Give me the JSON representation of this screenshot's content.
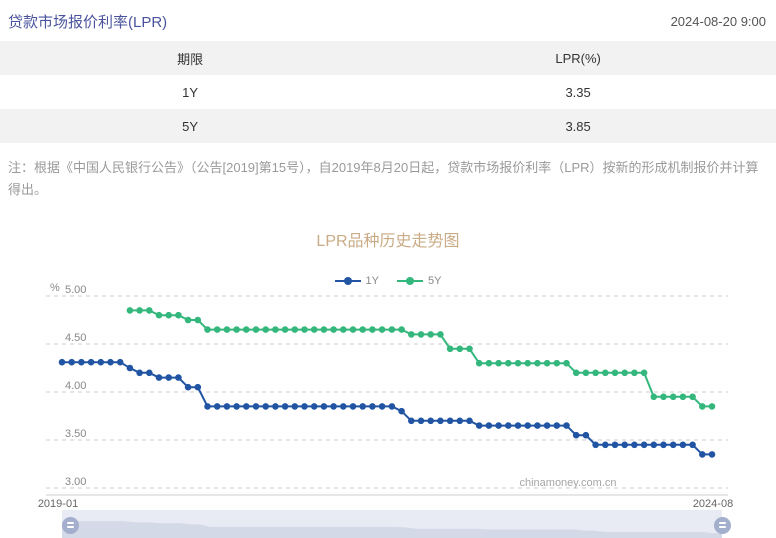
{
  "header": {
    "title": "贷款市场报价利率(LPR)",
    "datetime": "2024-08-20 9:00"
  },
  "table": {
    "columns": [
      "期限",
      "LPR(%)"
    ],
    "rows": [
      {
        "term": "1Y",
        "rate": "3.35"
      },
      {
        "term": "5Y",
        "rate": "3.85"
      }
    ]
  },
  "note": "注：根据《中国人民银行公告》（公告[2019]第15号），自2019年8月20日起，贷款市场报价利率（LPR）按新的形成机制报价并计算得出。",
  "colors": {
    "title": "#4a549e",
    "chart_title": "#c9ab85",
    "blue_1y": "#2155a3",
    "green_5y": "#34b77c",
    "gridline": "#cccccc",
    "axis_line": "#cccccc",
    "slider_track": "#e8ebf3",
    "slider_shadow": "#d3d9e7",
    "slider_handle": "#a4aecd"
  },
  "chart_data": {
    "type": "line",
    "title": "LPR品种历史走势图",
    "ylabel": "%",
    "ylim": [
      3.0,
      5.0
    ],
    "yticks": [
      "5.00",
      "4.50",
      "4.00",
      "3.50",
      "3.00"
    ],
    "x_range": [
      "2019-01",
      "2024-08"
    ],
    "grid": "horizontal dashed",
    "legend_position": "top-center",
    "watermark": "chinamoney.com.cn",
    "x": [
      "2019-01",
      "2019-02",
      "2019-03",
      "2019-04",
      "2019-05",
      "2019-06",
      "2019-07",
      "2019-08",
      "2019-09",
      "2019-10",
      "2019-11",
      "2019-12",
      "2020-01",
      "2020-02",
      "2020-03",
      "2020-04",
      "2020-05",
      "2020-06",
      "2020-07",
      "2020-08",
      "2020-09",
      "2020-10",
      "2020-11",
      "2020-12",
      "2021-01",
      "2021-02",
      "2021-03",
      "2021-04",
      "2021-05",
      "2021-06",
      "2021-07",
      "2021-08",
      "2021-09",
      "2021-10",
      "2021-11",
      "2021-12",
      "2022-01",
      "2022-02",
      "2022-03",
      "2022-04",
      "2022-05",
      "2022-06",
      "2022-07",
      "2022-08",
      "2022-09",
      "2022-10",
      "2022-11",
      "2022-12",
      "2023-01",
      "2023-02",
      "2023-03",
      "2023-04",
      "2023-05",
      "2023-06",
      "2023-07",
      "2023-08",
      "2023-09",
      "2023-10",
      "2023-11",
      "2023-12",
      "2024-01",
      "2024-02",
      "2024-03",
      "2024-04",
      "2024-05",
      "2024-06",
      "2024-07",
      "2024-08"
    ],
    "series": [
      {
        "name": "1Y",
        "color": "#2155a3",
        "values": [
          4.31,
          4.31,
          4.31,
          4.31,
          4.31,
          4.31,
          4.31,
          4.25,
          4.2,
          4.2,
          4.15,
          4.15,
          4.15,
          4.05,
          4.05,
          3.85,
          3.85,
          3.85,
          3.85,
          3.85,
          3.85,
          3.85,
          3.85,
          3.85,
          3.85,
          3.85,
          3.85,
          3.85,
          3.85,
          3.85,
          3.85,
          3.85,
          3.85,
          3.85,
          3.85,
          3.8,
          3.7,
          3.7,
          3.7,
          3.7,
          3.7,
          3.7,
          3.7,
          3.65,
          3.65,
          3.65,
          3.65,
          3.65,
          3.65,
          3.65,
          3.65,
          3.65,
          3.65,
          3.55,
          3.55,
          3.45,
          3.45,
          3.45,
          3.45,
          3.45,
          3.45,
          3.45,
          3.45,
          3.45,
          3.45,
          3.45,
          3.35,
          3.35
        ]
      },
      {
        "name": "5Y",
        "color": "#34b77c",
        "values": [
          null,
          null,
          null,
          null,
          null,
          null,
          null,
          4.85,
          4.85,
          4.85,
          4.8,
          4.8,
          4.8,
          4.75,
          4.75,
          4.65,
          4.65,
          4.65,
          4.65,
          4.65,
          4.65,
          4.65,
          4.65,
          4.65,
          4.65,
          4.65,
          4.65,
          4.65,
          4.65,
          4.65,
          4.65,
          4.65,
          4.65,
          4.65,
          4.65,
          4.65,
          4.6,
          4.6,
          4.6,
          4.6,
          4.45,
          4.45,
          4.45,
          4.3,
          4.3,
          4.3,
          4.3,
          4.3,
          4.3,
          4.3,
          4.3,
          4.3,
          4.3,
          4.2,
          4.2,
          4.2,
          4.2,
          4.2,
          4.2,
          4.2,
          4.2,
          3.95,
          3.95,
          3.95,
          3.95,
          3.95,
          3.85,
          3.85
        ]
      }
    ]
  }
}
